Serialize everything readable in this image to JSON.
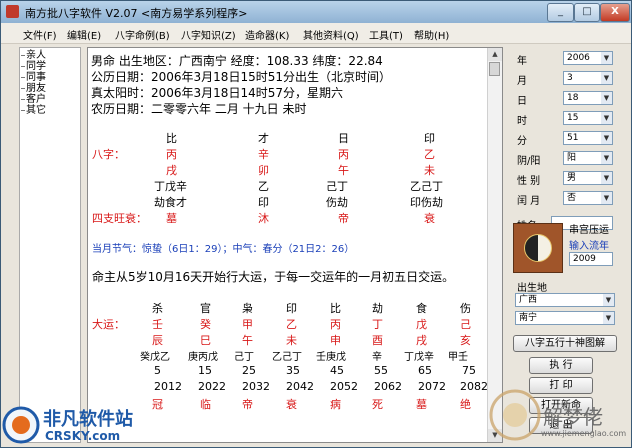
{
  "window": {
    "title": "南方批八字软件 V2.07  <南方易学系列程序>",
    "min": "_",
    "max": "□",
    "close": "X"
  },
  "menu": [
    "文件(F)",
    "编辑(E)",
    "八字命例(B)",
    "八字知识(Z)",
    "造命器(K)",
    "其他资料(Q)",
    "工具(T)",
    "帮助(H)"
  ],
  "sidebar": [
    "亲人",
    "同学",
    "同事",
    "朋友",
    "客户",
    "其它"
  ],
  "info": {
    "line1": "男命      出生地区：广西南宁  经度：108.33 纬度：22.84",
    "line2": "公历日期：2006年3月18日15时51分出生（北京时间）",
    "line3": "真太阳时：2006年3月18日14时57分，星期六",
    "line4": "农历日期：二零零六年      二月      十九日      未时"
  },
  "bazi": {
    "label": "八字：",
    "wangshuai_label": "四支旺衰：",
    "shishen": [
      "比",
      "才",
      "日",
      "印"
    ],
    "gan": [
      "丙",
      "辛",
      "丙",
      "乙"
    ],
    "zhi": [
      "戌",
      "卯",
      "午",
      "未"
    ],
    "canggan": [
      "丁戊辛",
      "乙",
      "己丁",
      "乙己丁"
    ],
    "canggan_shishen": [
      "劫食才",
      "印",
      "伤劫",
      "印伤劫"
    ],
    "wangshuai": [
      "墓",
      "沐",
      "帝",
      "衰"
    ]
  },
  "jieqi": "当月节气：惊蛰（6日1：29）；中气：春分（21日2：26）",
  "dayun_intro": "命主从5岁10月16天开始行大运，于每一交运年的一月初五日交运。",
  "dayun": {
    "label": "大运：",
    "shishen": [
      "杀",
      "官",
      "枭",
      "印",
      "比",
      "劫",
      "食",
      "伤"
    ],
    "gan": [
      "壬",
      "癸",
      "甲",
      "乙",
      "丙",
      "丁",
      "戊",
      "己"
    ],
    "zhi": [
      "辰",
      "巳",
      "午",
      "未",
      "申",
      "酉",
      "戌",
      "亥"
    ],
    "canggan": [
      "癸戊乙",
      "庚丙戊",
      "己丁",
      "乙己丁",
      "壬庚戊",
      "辛",
      "丁戊辛",
      "甲壬"
    ],
    "age": [
      "5",
      "15",
      "25",
      "35",
      "45",
      "55",
      "65",
      "75"
    ],
    "year": [
      "2012",
      "2022",
      "2032",
      "2042",
      "2052",
      "2062",
      "2072",
      "2082"
    ],
    "state": [
      "冠",
      "临",
      "帝",
      "衰",
      "病",
      "死",
      "墓",
      "绝"
    ]
  },
  "form": {
    "fields": [
      {
        "label": "年",
        "value": "2006"
      },
      {
        "label": "月",
        "value": "3"
      },
      {
        "label": "日",
        "value": "18"
      },
      {
        "label": "时",
        "value": "15"
      },
      {
        "label": "分",
        "value": "51"
      },
      {
        "label": "阴/阳",
        "value": "阳"
      },
      {
        "label": "性 别",
        "value": "男"
      },
      {
        "label": "闰 月",
        "value": "否"
      }
    ],
    "name_label": "姓名",
    "name_value": "",
    "chongguan_label": "串宫压运",
    "liunian_label": "输入流年",
    "liunian_value": "2009",
    "birthplace_label": "出生地",
    "province": "广西",
    "city": "南宁",
    "btn_wuxing": "八字五行十神图解",
    "btn_execute": "执 行",
    "btn_print": "打 印",
    "btn_extra": "打开新命",
    "btn_exit": "退 出"
  },
  "watermark": {
    "brand": "非凡软件站",
    "domain": "CRSKY.com",
    "site": "解梦佬",
    "site_url": "www.jiemenglao.com"
  }
}
